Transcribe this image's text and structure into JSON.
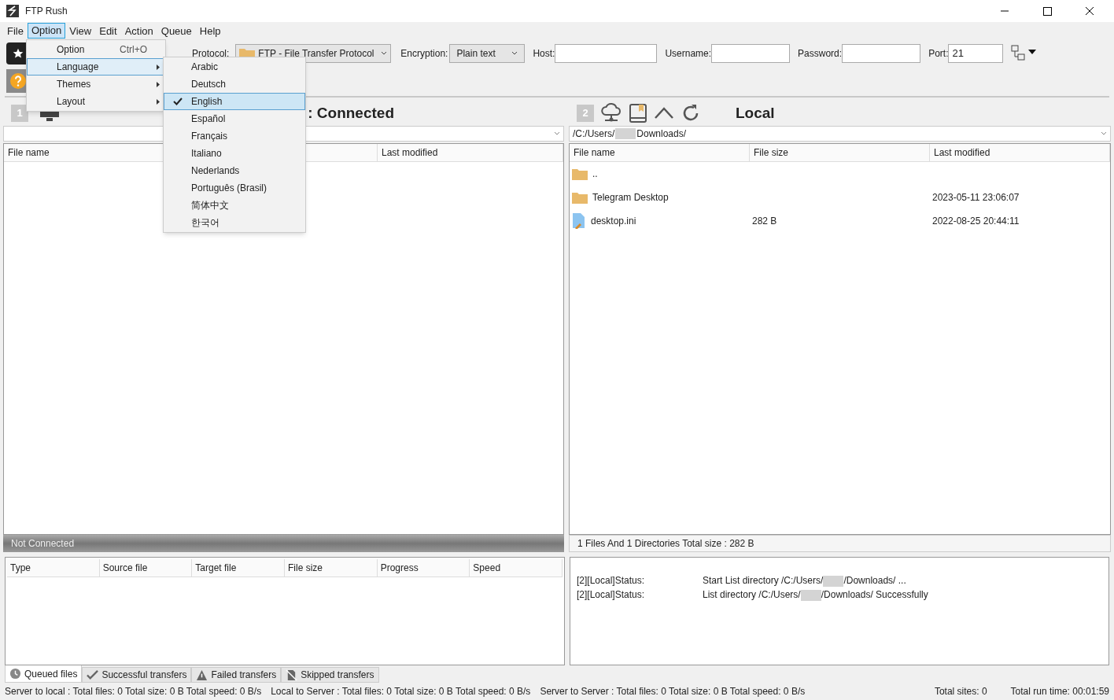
{
  "window": {
    "title": "FTP Rush"
  },
  "menu_bar": [
    {
      "label": "File",
      "selected": false
    },
    {
      "label": "Option",
      "selected": true
    },
    {
      "label": "View",
      "selected": false
    },
    {
      "label": "Edit",
      "selected": false
    },
    {
      "label": "Action",
      "selected": false
    },
    {
      "label": "Queue",
      "selected": false
    },
    {
      "label": "Help",
      "selected": false
    }
  ],
  "option_menu": [
    {
      "label": "Option",
      "shortcut": "Ctrl+O",
      "submenu": false,
      "selected": false
    },
    {
      "label": "Language",
      "submenu": true,
      "selected": true
    },
    {
      "label": "Themes",
      "submenu": true,
      "selected": false
    },
    {
      "label": "Layout",
      "submenu": true,
      "selected": false
    }
  ],
  "language_menu": [
    {
      "label": "Arabic",
      "checked": false,
      "selected": false
    },
    {
      "label": "Deutsch",
      "checked": false,
      "selected": false
    },
    {
      "label": "English",
      "checked": true,
      "selected": true
    },
    {
      "label": "Español",
      "checked": false,
      "selected": false
    },
    {
      "label": "Français",
      "checked": false,
      "selected": false
    },
    {
      "label": "Italiano",
      "checked": false,
      "selected": false
    },
    {
      "label": "Nederlands",
      "checked": false,
      "selected": false
    },
    {
      "label": "Português (Brasil)",
      "checked": false,
      "selected": false
    },
    {
      "label": "简体中文",
      "checked": false,
      "selected": false
    },
    {
      "label": "한국어",
      "checked": false,
      "selected": false
    }
  ],
  "connection": {
    "protocol_label": "Protocol:",
    "protocol": "FTP - File Transfer Protocol",
    "encryption_label": "Encryption:",
    "encryption": "Plain text",
    "host_label": "Host:",
    "username_label": "Username:",
    "password_label": "Password:",
    "port_label": "Port:",
    "port": "21"
  },
  "left_panel": {
    "number": "1",
    "title": ": Connected",
    "columns": [
      "File name",
      "Last modified"
    ],
    "status": "Not Connected"
  },
  "right_panel": {
    "number": "2",
    "title": "Local",
    "path_start": "/C:/Users/",
    "path_end": "Downloads/",
    "columns": [
      "File name",
      "File size",
      "Last modified"
    ],
    "rows": [
      {
        "kind": "folder",
        "name": "..",
        "size": "",
        "modified": ""
      },
      {
        "kind": "folder",
        "name": "Telegram Desktop",
        "modified": "2023-05-11 23:06:07"
      },
      {
        "kind": "file",
        "name": "desktop.ini",
        "size": "282 B",
        "modified": "2022-08-25 20:44:11"
      }
    ],
    "status": "1 Files And 1 Directories Total size : 282 B"
  },
  "transfers": {
    "columns": [
      "Type",
      "Source file",
      "Target file",
      "File size",
      "Progress",
      "Speed"
    ],
    "tabs": [
      {
        "kind": "clock",
        "label": "Queued files",
        "selected": true
      },
      {
        "kind": "check",
        "label": "Successful transfers",
        "selected": false
      },
      {
        "kind": "warning",
        "label": "Failed transfers",
        "selected": false
      },
      {
        "kind": "skipped",
        "label": "Skipped transfers",
        "selected": false
      }
    ]
  },
  "log": [
    {
      "source": "[2][Local]Status:",
      "start": "Start List directory /C:/Users/",
      "end": "/Downloads/ ..."
    },
    {
      "source": "[2][Local]Status:",
      "start": "List directory /C:/Users/",
      "end": "/Downloads/ Successfully"
    }
  ],
  "status_bar": [
    "Server to local : Total files: 0  Total size: 0 B  Total speed: 0 B/s",
    "Local to Server : Total files: 0  Total size: 0 B  Total speed: 0 B/s",
    "Server to Server : Total files: 0  Total size: 0 B  Total speed: 0 B/s",
    "Total sites: 0",
    "Total run time: 00:01:59"
  ]
}
